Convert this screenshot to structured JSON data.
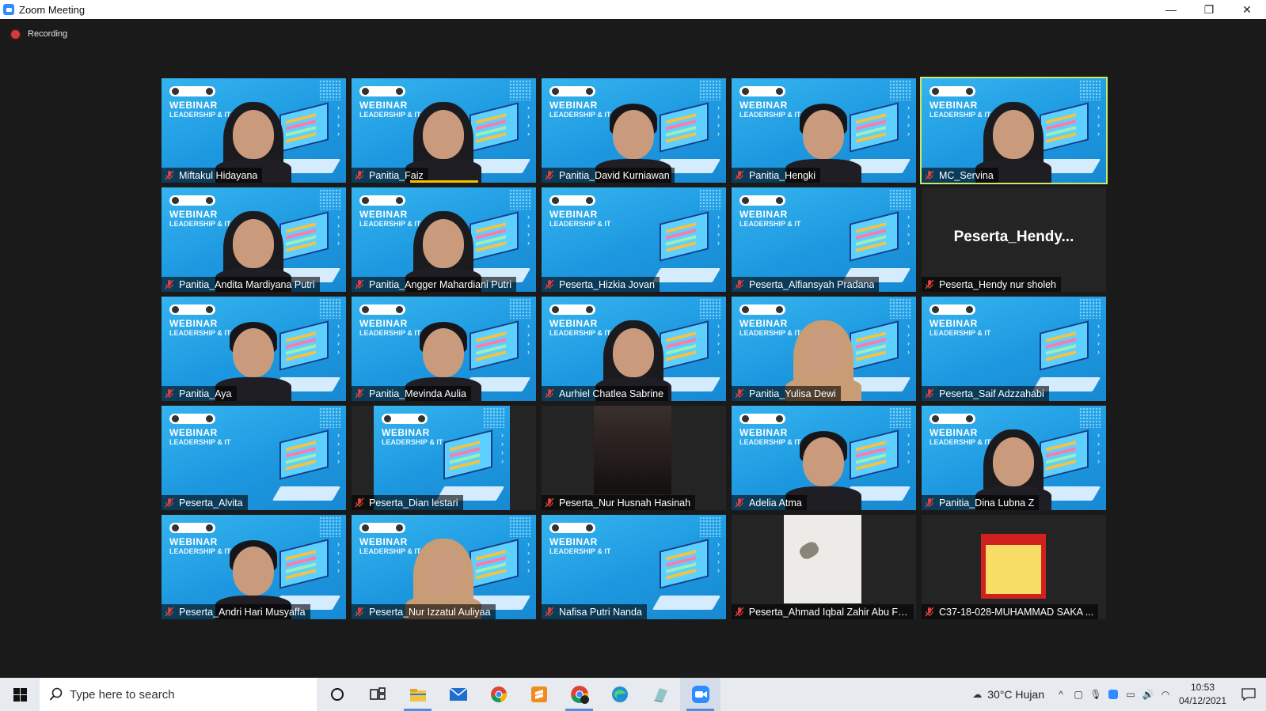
{
  "window": {
    "title": "Zoom Meeting"
  },
  "recording": {
    "label": "Recording"
  },
  "participants": [
    {
      "name": "Miftakul Hidayana",
      "video": "webinar",
      "person": "hijab"
    },
    {
      "name": "Panitia_Faiz",
      "video": "webinar",
      "person": "hijab",
      "speaking": true
    },
    {
      "name": "Panitia_David Kurniawan",
      "video": "webinar",
      "person": "hair"
    },
    {
      "name": "Panitia_Hengki",
      "video": "webinar",
      "person": "hair"
    },
    {
      "name": "MC_Servina",
      "video": "webinar",
      "person": "hijab",
      "active": true
    },
    {
      "name": "Panitia_Andita Mardiyana Putri",
      "video": "webinar",
      "person": "hijab"
    },
    {
      "name": "Panitia_Angger Mahardiani Putri",
      "video": "webinar",
      "person": "hijab"
    },
    {
      "name": "Peserta_Hizkia Jovan",
      "video": "webinar",
      "person": "none"
    },
    {
      "name": "Peserta_Alfiansyah Pradana",
      "video": "webinar",
      "person": "none"
    },
    {
      "name": "Peserta_Hendy nur sholeh",
      "video": "off",
      "display_name": "Peserta_Hendy..."
    },
    {
      "name": "Panitia_Aya",
      "video": "webinar",
      "person": "hair"
    },
    {
      "name": "Panitia_Mevinda Aulia",
      "video": "webinar",
      "person": "hair"
    },
    {
      "name": "Aurhiel Chatlea Sabrine",
      "video": "webinar",
      "person": "hijab"
    },
    {
      "name": "Panitia_Yulisa Dewi",
      "video": "webinar",
      "person": "hijab-light"
    },
    {
      "name": "Peserta_Saif Adzzahabi",
      "video": "webinar",
      "person": "none"
    },
    {
      "name": "Peserta_Alvita",
      "video": "webinar",
      "person": "none"
    },
    {
      "name": "Peserta_Dian lestari",
      "video": "narrow",
      "person": "none"
    },
    {
      "name": "Peserta_Nur Husnah Hasinah",
      "video": "dark",
      "person": "none"
    },
    {
      "name": "Adelia Atma",
      "video": "webinar",
      "person": "hair"
    },
    {
      "name": "Panitia_Dina Lubna Z",
      "video": "webinar",
      "person": "hijab"
    },
    {
      "name": "Peserta_Andri Hari Musyaffa",
      "video": "webinar",
      "person": "hair"
    },
    {
      "name": "Peserta_Nur Izzatul Auliyaa",
      "video": "webinar",
      "person": "hijab-light"
    },
    {
      "name": "Nafisa Putri Nanda",
      "video": "webinar",
      "person": "none"
    },
    {
      "name": "Peserta_Ahmad Iqbal Zahir Abu Fa...",
      "video": "white",
      "person": "none"
    },
    {
      "name": "C37-18-028-MUHAMMAD SAKA ...",
      "video": "red",
      "person": "none"
    }
  ],
  "webinar_bg": {
    "line1": "WEBINAR",
    "line2": "LEADERSHIP & IT"
  },
  "taskbar": {
    "search_placeholder": "Type here to search",
    "weather": "30°C  Hujan",
    "time": "10:53",
    "date": "04/12/2021",
    "apps": [
      "cortana-icon",
      "task-view-icon",
      "file-explorer-icon",
      "mail-icon",
      "chrome-icon",
      "sublime-icon",
      "chrome-profile-icon",
      "edge-icon",
      "app-icon",
      "zoom-icon"
    ]
  },
  "colors": {
    "muted_mic": "#e0413d",
    "active_border": "#c8e86a",
    "speaking": "#f0c300",
    "zoom_blue": "#2d8cff"
  }
}
